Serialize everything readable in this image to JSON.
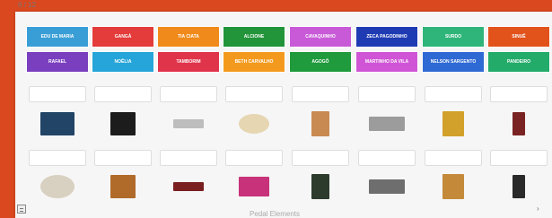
{
  "window": {
    "title": "6 / 12"
  },
  "buttons": [
    {
      "label": "Edu de Maria",
      "color": "#3a9ed6"
    },
    {
      "label": "Gangá",
      "color": "#e43b3b"
    },
    {
      "label": "Tia Ciata",
      "color": "#f08a1a"
    },
    {
      "label": "Alcione",
      "color": "#22943a"
    },
    {
      "label": "Cavaquinho",
      "color": "#c85ad8"
    },
    {
      "label": "Zeca Pagodinho",
      "color": "#1f3bb4"
    },
    {
      "label": "Surdo",
      "color": "#2fb57a"
    },
    {
      "label": "Sinuê",
      "color": "#e2531c"
    },
    {
      "label": "Rafael",
      "color": "#7a3fbf"
    },
    {
      "label": "Noêlia",
      "color": "#25a5d9"
    },
    {
      "label": "Tamborim",
      "color": "#e0344b"
    },
    {
      "label": "Beth Carvalho",
      "color": "#f39a1e"
    },
    {
      "label": "Agogô",
      "color": "#1f9a3c"
    },
    {
      "label": "Martinho da Vila",
      "color": "#d055d6"
    },
    {
      "label": "Nelson Sargento",
      "color": "#2f69d4"
    },
    {
      "label": "Pandeiro",
      "color": "#23ab6a"
    }
  ],
  "images_row1": [
    {
      "name": "portrait-singer-image",
      "bg": "#224466"
    },
    {
      "name": "reco-reco-instrument-image",
      "bg": "#1c1c1c"
    },
    {
      "name": "ganza-instrument-image",
      "bg": "#bdbdbd"
    },
    {
      "name": "pandeiro-instrument-image",
      "bg": "#e6d6b2"
    },
    {
      "name": "surdo-instrument-image",
      "bg": "#c98a52"
    },
    {
      "name": "agogo-instrument-image",
      "bg": "#9c9c9c"
    },
    {
      "name": "portrait-singer-image",
      "bg": "#d2a12b"
    },
    {
      "name": "portrait-singer-image",
      "bg": "#7a2323"
    }
  ],
  "images_row2": [
    {
      "name": "tamborim-instrument-image",
      "bg": "#d8d0c0"
    },
    {
      "name": "cavaquinho-instrument-image",
      "bg": "#b06b2b"
    },
    {
      "name": "portrait-singer-image",
      "bg": "#7a1f1f"
    },
    {
      "name": "portrait-singer-image",
      "bg": "#c8327a"
    },
    {
      "name": "portrait-singer-image",
      "bg": "#2d3b2d"
    },
    {
      "name": "portrait-singer-image",
      "bg": "#6e6e6e"
    },
    {
      "name": "portrait-singer-image",
      "bg": "#c48a3a"
    },
    {
      "name": "portrait-singer-image",
      "bg": "#2a2a2a"
    }
  ],
  "footer": {
    "label": "Pedal Elements"
  }
}
